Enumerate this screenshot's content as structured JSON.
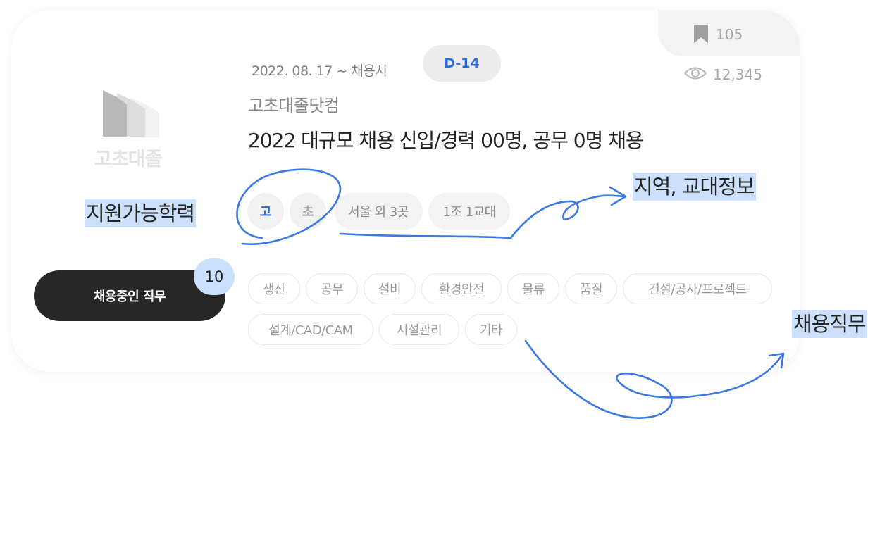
{
  "stats": {
    "bookmark_count": "105",
    "view_count": "12,345"
  },
  "company_logo": {
    "text": "고초대졸"
  },
  "posting": {
    "date_range": "2022. 08. 17 ~ 채용시",
    "dday": "D-14",
    "company": "고초대졸닷컴",
    "title": "2022 대규모 채용 신입/경력 00명, 공무 0명 채용"
  },
  "education_levels": [
    "고",
    "초"
  ],
  "info_tags": {
    "region": "서울 외 3곳",
    "school": "1조 1교대"
  },
  "jobs": [
    "생산",
    "공무",
    "설비",
    "환경안전",
    "물류",
    "품질",
    "건설/공사/프로젝트",
    "설계/CAD/CAM",
    "시설관리",
    "기타"
  ],
  "button": {
    "label": "채용중인 직무",
    "count": "10"
  },
  "annotations": {
    "education": "지원가능학력",
    "region": "지역, 교대정보",
    "jobs": "채용직무"
  },
  "colors": {
    "accent_blue": "#2d6be0",
    "annotation_highlight": "#cde0fb",
    "button_dark": "#272727"
  }
}
